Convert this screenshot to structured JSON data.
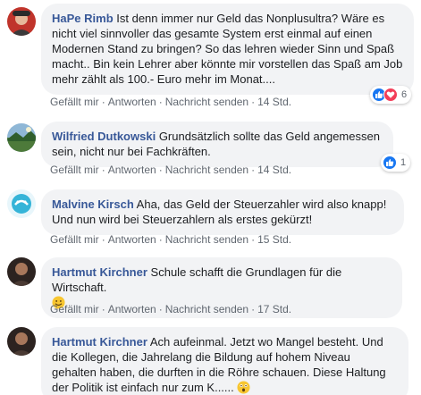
{
  "comments": [
    {
      "author": "HaPe Rimb",
      "text": "Ist denn immer nur Geld das Nonplusultra? Wäre es nicht viel sinnvoller das gesamte System erst einmal auf einen Modernen Stand zu bringen? So das lehren wieder Sinn und Spaß macht.. Bin kein Lehrer aber könnte mir vorstellen das Spaß am Job mehr zählt als 100.- Euro mehr im Monat....",
      "like": "Gefällt mir",
      "reply": "Antworten",
      "report": "Nachricht senden",
      "time": "14 Std.",
      "reaction_count": "6",
      "reaction_icons": [
        "like-icon",
        "love-icon"
      ]
    },
    {
      "author": "Wilfried Dutkowski",
      "text": "Grundsätzlich sollte das Geld angemessen sein, nicht nur bei Fachkräften.",
      "like": "Gefällt mir",
      "reply": "Antworten",
      "report": "Nachricht senden",
      "time": "14 Std.",
      "reaction_count": "1",
      "reaction_icons": [
        "like-icon"
      ]
    },
    {
      "author": "Malvine Kirsch",
      "text": "Aha, das Geld der Steuerzahler wird also knapp! Und nun wird bei Steuerzahlern als erstes gekürzt!",
      "like": "Gefällt mir",
      "reply": "Antworten",
      "report": "Nachricht senden",
      "time": "15 Std."
    },
    {
      "author": "Hartmut Kirchner",
      "text": "Schule schafft die Grundlagen für die Wirtschaft.",
      "emoji": "smile-emoji",
      "like": "Gefällt mir",
      "reply": "Antworten",
      "report": "Nachricht senden",
      "time": "17 Std."
    },
    {
      "author": "Hartmut Kirchner",
      "text": "Ach aufeinmal. Jetzt wo Mangel besteht. Und die Kollegen, die Jahrelang die Bildung auf hohem Niveau gehalten haben, die durften in die Röhre schauen. Diese Haltung der Politik ist einfach nur zum K......",
      "emoji": "astonished-emoji"
    }
  ],
  "separator": "·",
  "colors": {
    "author": "#385898",
    "bubble": "#f2f3f5",
    "meta": "#606770",
    "like": "#1877f2",
    "love": "#f33e58"
  }
}
